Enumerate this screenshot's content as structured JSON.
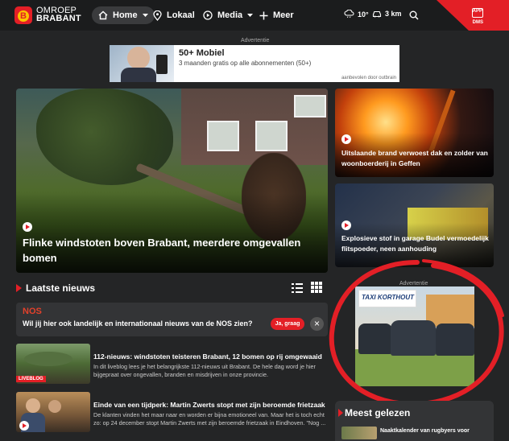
{
  "header": {
    "logo_badge": "B",
    "logo_line1": "OMROEP",
    "logo_line2": "BRABANT",
    "nav": [
      {
        "label": "Home",
        "icon": "home-icon"
      },
      {
        "label": "Lokaal",
        "icon": "location-pin-icon"
      },
      {
        "label": "Media",
        "icon": "play-circle-icon"
      },
      {
        "label": "Meer",
        "icon": "plus-icon"
      }
    ],
    "weather": "10°",
    "traffic": "3 km",
    "app_label_1": "APP",
    "app_label_2": "DMS",
    "accent": "#e31f26"
  },
  "ad_top": {
    "label": "Advertentie",
    "title": "50+ Mobiel",
    "subtitle": "3 maanden gratis op alle abonnementen (50+)",
    "source": "aanbevolen door outbrain"
  },
  "hero": {
    "title": "Flinke windstoten boven Brabant, meerdere omgevallen bomen"
  },
  "side_cards": [
    {
      "title": "Uitslaande brand verwoest dak en zolder van woonboerderij in Geffen"
    },
    {
      "title": "Explosieve stof in garage Budel vermoedelijk flitspoeder, neen aanhouding"
    }
  ],
  "latest": {
    "title": "Laatste nieuws"
  },
  "nos": {
    "logo": "NOS",
    "text": "Wil jij hier ook landelijk en internationaal nieuws van de NOS zien?",
    "button": "Ja, graag",
    "close": "×"
  },
  "news": [
    {
      "title": "112-nieuws: windstoten teisteren Brabant, 12 bomen op rij omgewaaid",
      "desc": "In dit liveblog lees je het belangrijkste 112-nieuws uit Brabant. De hele dag word je hier bijgepraat over ongevallen, branden en misdrijven in onze provincie.",
      "badge": "LIVEBLOG"
    },
    {
      "title": "Einde van een tijdperk: Martin Zwerts stopt met zijn beroemde frietzaak",
      "desc": "De klanten vinden het maar naar en worden er bijna emotioneel van. Maar het is toch echt zo: op 24 december stopt Martin Zwerts met zijn beroemde frietzaak in Eindhoven. \"Nog ..."
    }
  ],
  "ad_right": {
    "label": "Advertentie",
    "brand": "TAXI KORTHOUT"
  },
  "most_read": {
    "title": "Meest gelezen",
    "item": "Naaktkalender van rugbyers voor"
  }
}
